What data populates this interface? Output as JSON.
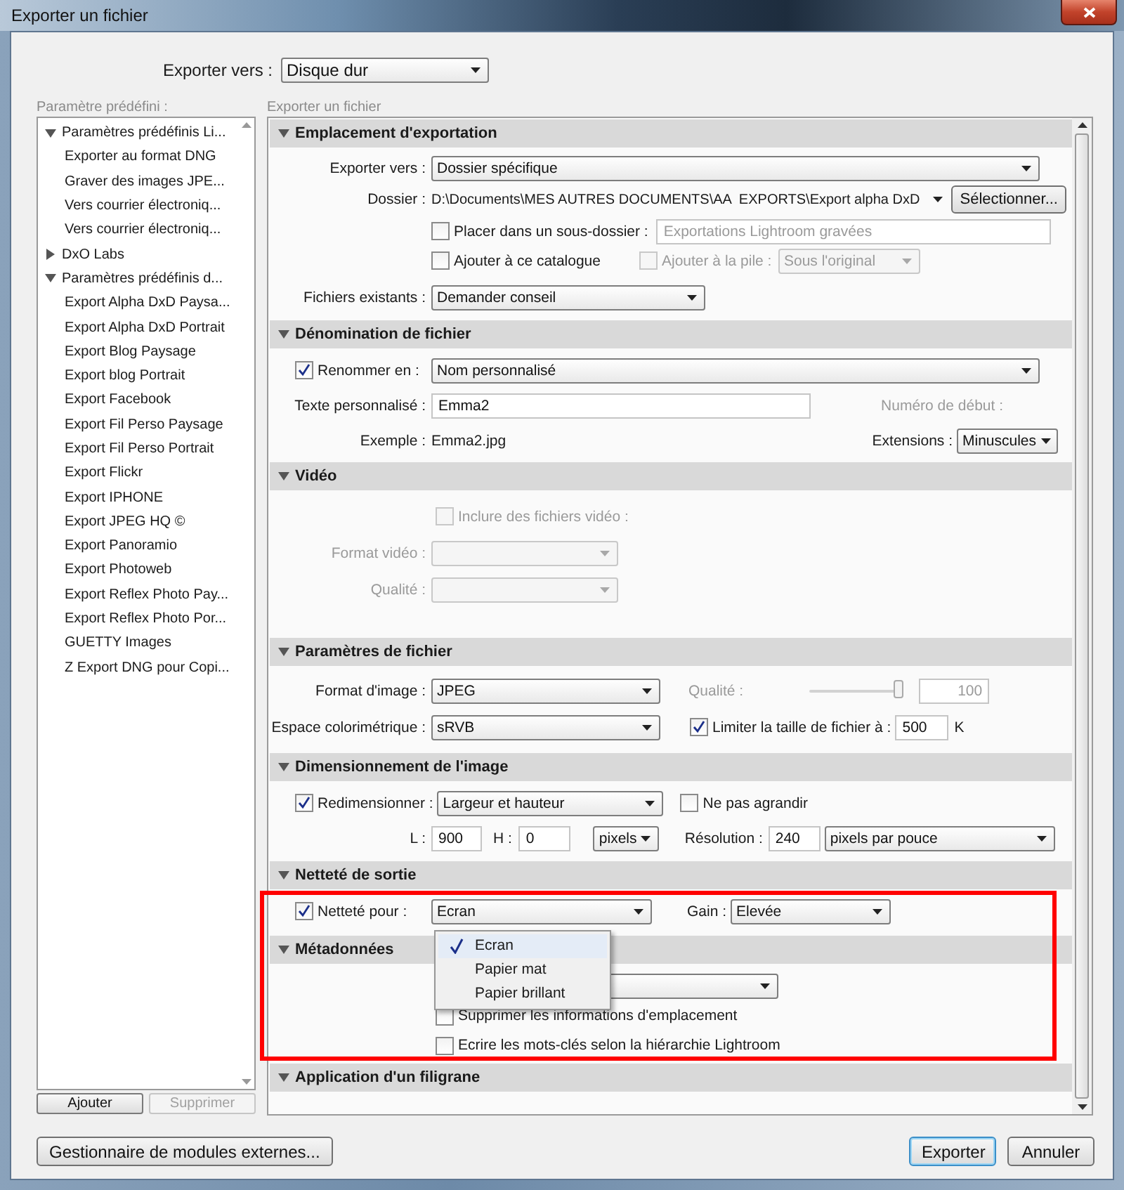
{
  "window": {
    "title": "Exporter un fichier"
  },
  "export_to": {
    "label": "Exporter vers :",
    "value": "Disque dur"
  },
  "presets": {
    "label": "Paramètre prédéfini :",
    "items": [
      {
        "label": "Paramètres prédéfinis Li...",
        "expanded": true,
        "children": [
          {
            "label": "Exporter au format DNG"
          },
          {
            "label": "Graver des images JPE..."
          },
          {
            "label": "Vers courrier électroniq..."
          },
          {
            "label": "Vers courrier électroniq..."
          }
        ]
      },
      {
        "label": "DxO Labs",
        "expanded": false
      },
      {
        "label": "Paramètres prédéfinis d...",
        "expanded": true,
        "children": [
          {
            "label": "Export Alpha DxD Paysa..."
          },
          {
            "label": "Export Alpha DxD Portrait"
          },
          {
            "label": "Export Blog Paysage"
          },
          {
            "label": "Export blog Portrait"
          },
          {
            "label": "Export Facebook"
          },
          {
            "label": "Export Fil Perso Paysage"
          },
          {
            "label": "Export Fil Perso Portrait"
          },
          {
            "label": "Export Flickr"
          },
          {
            "label": "Export IPHONE"
          },
          {
            "label": "Export JPEG HQ ©"
          },
          {
            "label": "Export Panoramio"
          },
          {
            "label": "Export Photoweb"
          },
          {
            "label": "Export Reflex Photo Pay..."
          },
          {
            "label": "Export Reflex Photo Por..."
          },
          {
            "label": "GUETTY Images"
          },
          {
            "label": "Z Export DNG pour Copi..."
          }
        ]
      }
    ],
    "buttons": [
      {
        "label": "Ajouter",
        "disabled": false
      },
      {
        "label": "Supprimer",
        "disabled": true
      }
    ]
  },
  "panel": {
    "title": "Exporter un fichier",
    "sections": [
      {
        "kind": "location",
        "title": "Emplacement d'exportation",
        "expanded": true,
        "export_to": {
          "label": "Exporter vers :",
          "value": "Dossier spécifique"
        },
        "folder": {
          "label": "Dossier :",
          "path": "D:\\Documents\\MES AUTRES DOCUMENTS\\AA  EXPORTS\\Export alpha DxD",
          "button": "Sélectionner..."
        },
        "subfolder": {
          "label": "Placer dans un sous-dossier :",
          "checked": false,
          "value": "Exportations Lightroom gravées"
        },
        "add_catalog": {
          "label": "Ajouter à ce catalogue",
          "checked": false
        },
        "add_stack": {
          "label": "Ajouter à la pile :",
          "checked": false,
          "disabled": true,
          "value": "Sous l'original"
        },
        "existing": {
          "label": "Fichiers existants :",
          "value": "Demander conseil"
        }
      },
      {
        "kind": "naming",
        "title": "Dénomination de fichier",
        "expanded": true,
        "rename": {
          "label": "Renommer en :",
          "checked": true,
          "value": "Nom personnalisé"
        },
        "custom_text": {
          "label": "Texte personnalisé :",
          "value": "Emma2"
        },
        "start_number": {
          "label": "Numéro de début :",
          "disabled": true
        },
        "example": {
          "label": "Exemple :",
          "value": "Emma2.jpg"
        },
        "extensions": {
          "label": "Extensions :",
          "value": "Minuscules"
        }
      },
      {
        "kind": "video",
        "title": "Vidéo",
        "expanded": true,
        "include": {
          "label": "Inclure des fichiers vidéo :",
          "checked": false,
          "disabled": true
        },
        "format": {
          "label": "Format vidéo :",
          "disabled": true
        },
        "quality": {
          "label": "Qualité :",
          "disabled": true
        }
      },
      {
        "kind": "file_settings",
        "title": "Paramètres de fichier",
        "expanded": true,
        "format": {
          "label": "Format d'image :",
          "value": "JPEG"
        },
        "quality": {
          "label": "Qualité :",
          "disabled": true,
          "level": 0.95,
          "value": "100"
        },
        "color_space": {
          "label": "Espace colorimétrique :",
          "value": "sRVB"
        },
        "limit": {
          "label": "Limiter la taille de fichier à :",
          "checked": true,
          "value": "500",
          "unit": "K"
        }
      },
      {
        "kind": "sizing",
        "title": "Dimensionnement de l'image",
        "expanded": true,
        "resize": {
          "label": "Redimensionner :",
          "checked": true,
          "value": "Largeur et hauteur"
        },
        "no_enlarge": {
          "label": "Ne pas agrandir",
          "checked": false
        },
        "width": {
          "label": "L :",
          "value": "900"
        },
        "height": {
          "label": "H :",
          "value": "0"
        },
        "unit": {
          "value": "pixels"
        },
        "resolution": {
          "label": "Résolution :",
          "value": "240"
        },
        "resolution_unit": {
          "value": "pixels par pouce"
        }
      },
      {
        "kind": "sharpening",
        "title": "Netteté de sortie",
        "expanded": true,
        "sharpen": {
          "label": "Netteté pour :",
          "checked": true,
          "value": "Ecran"
        },
        "menu": {
          "open": true,
          "items": [
            {
              "label": "Ecran",
              "selected": true
            },
            {
              "label": "Papier mat",
              "selected": false
            },
            {
              "label": "Papier brillant",
              "selected": false
            }
          ]
        },
        "gain": {
          "label": "Gain :",
          "value": "Elevée"
        }
      },
      {
        "kind": "metadata",
        "title": "Métadonnées",
        "expanded": true,
        "remove_location": {
          "label": "Supprimer les informations d'emplacement",
          "checked": false
        },
        "keywords": {
          "label": "Ecrire les mots-clés selon la hiérarchie Lightroom",
          "checked": false
        }
      },
      {
        "kind": "watermark",
        "title": "Application d'un filigrane",
        "expanded": true
      }
    ]
  },
  "footer": {
    "plugin_manager": "Gestionnaire de modules externes...",
    "export": "Exporter",
    "cancel": "Annuler"
  },
  "annotations": [
    {
      "kind": "frame",
      "color": "#ff0000"
    }
  ]
}
